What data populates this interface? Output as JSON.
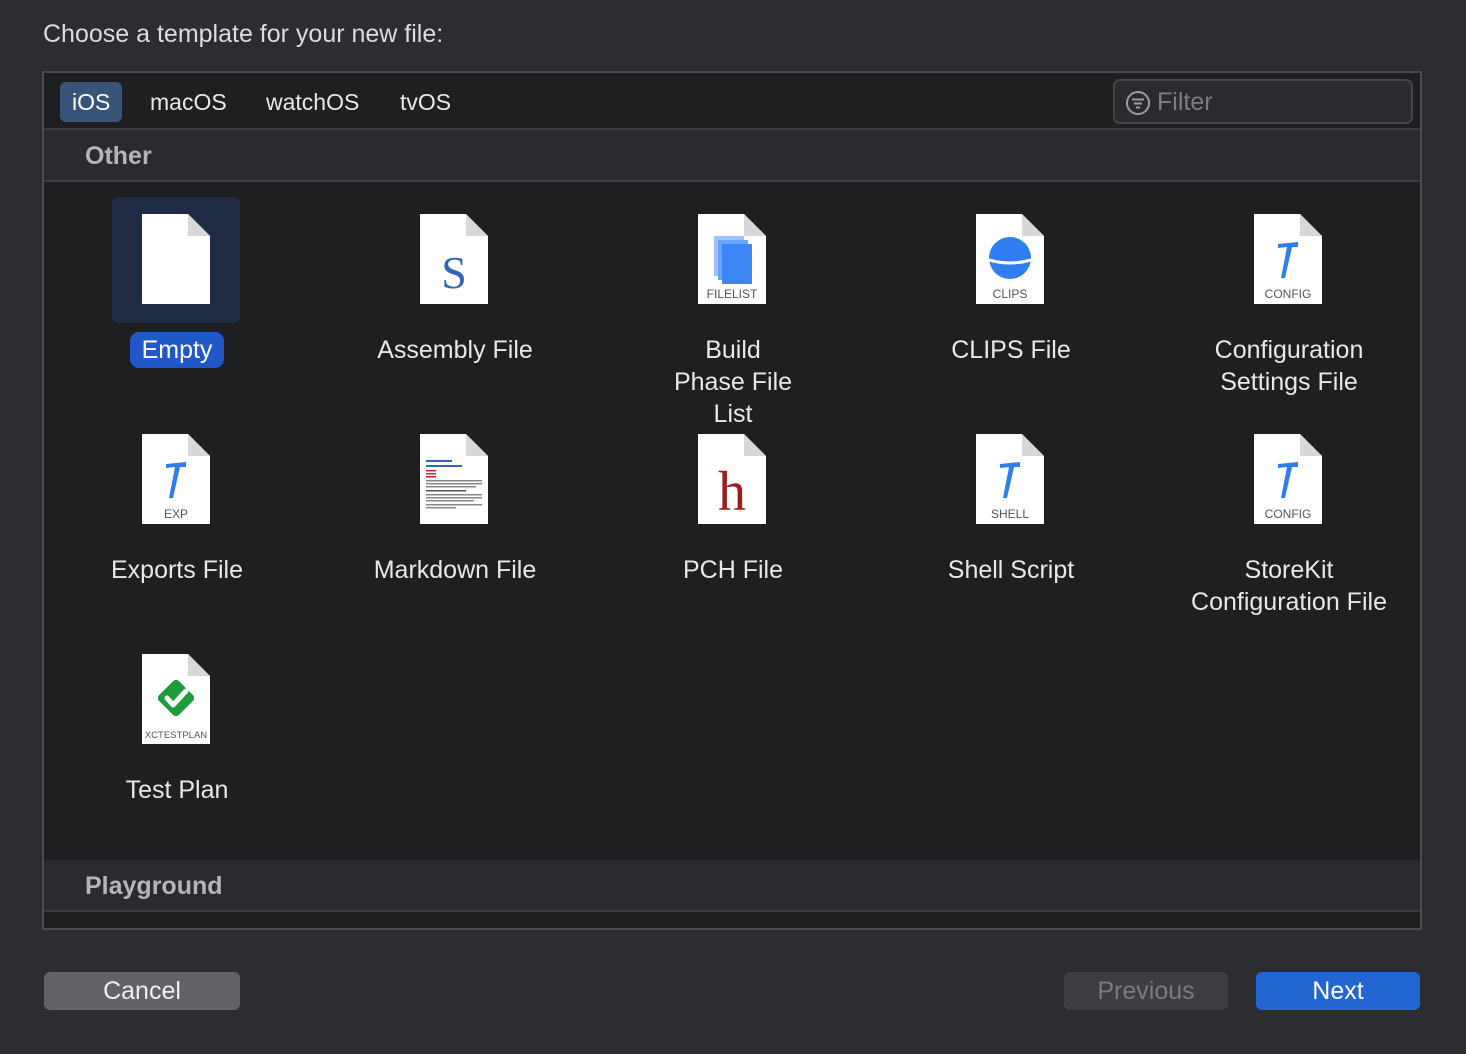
{
  "prompt": "Choose a template for your new file:",
  "tabs": [
    {
      "label": "iOS",
      "active": true
    },
    {
      "label": "macOS",
      "active": false
    },
    {
      "label": "watchOS",
      "active": false
    },
    {
      "label": "tvOS",
      "active": false
    }
  ],
  "filter": {
    "placeholder": "Filter",
    "icon": "filter-icon"
  },
  "sections": {
    "other": "Other",
    "playground": "Playground"
  },
  "templates": [
    {
      "label": "Empty",
      "icon": "empty-file-icon",
      "badge": "",
      "selected": true
    },
    {
      "label": "Assembly File",
      "icon": "assembly-file-icon",
      "badge": "S",
      "selected": false
    },
    {
      "label": "Build Phase File List",
      "icon": "filelist-icon",
      "badge": "FILELIST",
      "selected": false
    },
    {
      "label": "CLIPS File",
      "icon": "clips-file-icon",
      "badge": "CLIPS",
      "selected": false
    },
    {
      "label": "Configuration Settings File",
      "icon": "config-file-icon",
      "badge": "CONFIG",
      "selected": false
    },
    {
      "label": "Exports File",
      "icon": "exports-file-icon",
      "badge": "EXP",
      "selected": false
    },
    {
      "label": "Markdown File",
      "icon": "markdown-file-icon",
      "badge": "",
      "selected": false
    },
    {
      "label": "PCH File",
      "icon": "pch-file-icon",
      "badge": "h",
      "selected": false
    },
    {
      "label": "Shell Script",
      "icon": "shell-script-icon",
      "badge": "SHELL",
      "selected": false
    },
    {
      "label": "StoreKit Configuration File",
      "icon": "storekit-config-icon",
      "badge": "CONFIG",
      "selected": false
    },
    {
      "label": "Test Plan",
      "icon": "test-plan-icon",
      "badge": "XCTESTPLAN",
      "selected": false
    }
  ],
  "buttons": {
    "cancel": "Cancel",
    "previous": "Previous",
    "next": "Next"
  },
  "colors": {
    "accent": "#2465d4",
    "selection": "#2057c9",
    "tab_active": "#395479"
  }
}
